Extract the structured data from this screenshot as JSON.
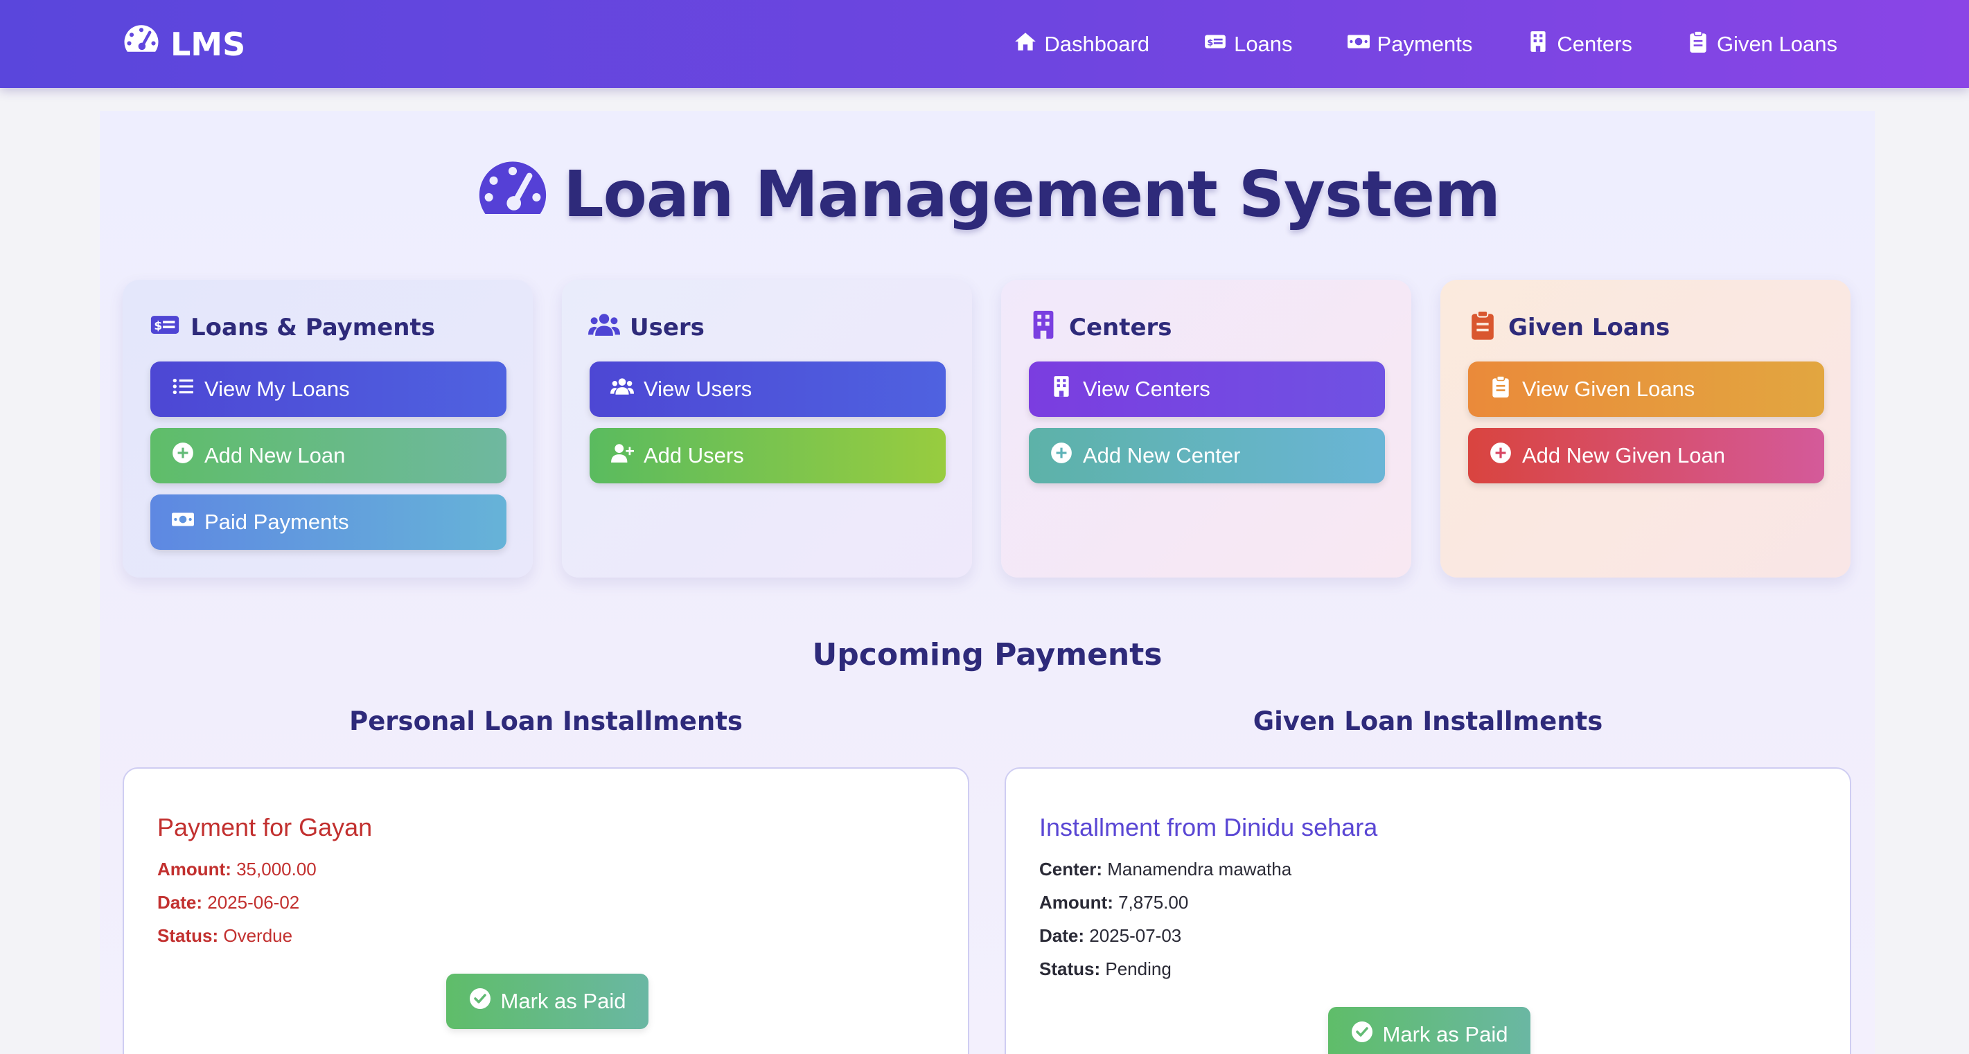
{
  "navbar": {
    "brand": "LMS",
    "brand_icon": "tachometer-icon",
    "links": [
      {
        "label": "Dashboard",
        "icon": "home-icon"
      },
      {
        "label": "Loans",
        "icon": "money-check-icon"
      },
      {
        "label": "Payments",
        "icon": "money-bill-icon"
      },
      {
        "label": "Centers",
        "icon": "building-icon"
      },
      {
        "label": "Given Loans",
        "icon": "clipboard-icon"
      }
    ]
  },
  "hero": {
    "title": "Loan Management System",
    "icon": "tachometer-icon"
  },
  "cards": [
    {
      "title": "Loans & Payments",
      "icon": "money-check-icon",
      "buttons": [
        {
          "label": "View My Loans",
          "icon": "list-icon"
        },
        {
          "label": "Add New Loan",
          "icon": "plus-circle-icon"
        },
        {
          "label": "Paid Payments",
          "icon": "money-bill-icon"
        }
      ]
    },
    {
      "title": "Users",
      "icon": "users-icon",
      "buttons": [
        {
          "label": "View Users",
          "icon": "users-icon"
        },
        {
          "label": "Add Users",
          "icon": "user-plus-icon"
        }
      ]
    },
    {
      "title": "Centers",
      "icon": "building-icon",
      "buttons": [
        {
          "label": "View Centers",
          "icon": "building-icon"
        },
        {
          "label": "Add New Center",
          "icon": "plus-circle-icon"
        }
      ]
    },
    {
      "title": "Given Loans",
      "icon": "clipboard-icon",
      "buttons": [
        {
          "label": "View Given Loans",
          "icon": "clipboard-icon"
        },
        {
          "label": "Add New Given Loan",
          "icon": "plus-circle-icon"
        }
      ]
    }
  ],
  "upcoming": {
    "title": "Upcoming Payments",
    "personal": {
      "heading": "Personal Loan Installments",
      "items": [
        {
          "title": "Payment for Gayan",
          "amount_label": "Amount:",
          "amount": "35,000.00",
          "date_label": "Date:",
          "date": "2025-06-02",
          "status_label": "Status:",
          "status": "Overdue",
          "button": "Mark as Paid"
        }
      ]
    },
    "given": {
      "heading": "Given Loan Installments",
      "items": [
        {
          "title": "Installment from Dinidu sehara",
          "center_label": "Center:",
          "center": "Manamendra mawatha",
          "amount_label": "Amount:",
          "amount": "7,875.00",
          "date_label": "Date:",
          "date": "2025-07-03",
          "status_label": "Status:",
          "status": "Pending",
          "button": "Mark as Paid"
        }
      ]
    }
  },
  "colors": {
    "nav_start": "#5a46dc",
    "nav_end": "#8a45e6",
    "heading": "#2e2a7a",
    "overdue": "#c2302f",
    "accent": "#5a47d4"
  }
}
